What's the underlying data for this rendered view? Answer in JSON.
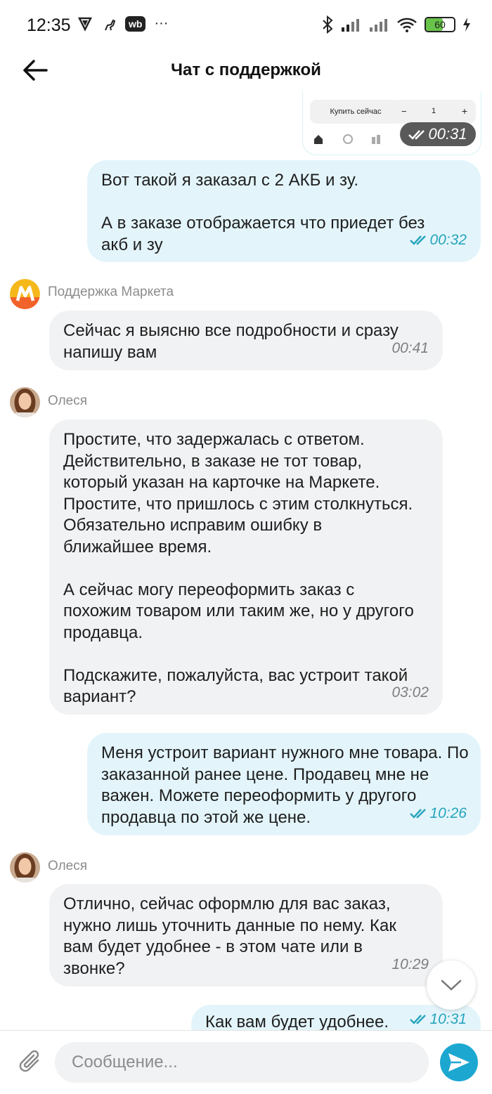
{
  "status_bar": {
    "time": "12:35",
    "wb_label": "wb",
    "more": "···",
    "battery": "60"
  },
  "header": {
    "title": "Чат с поддержкой"
  },
  "image_message": {
    "buy_label": "Купить сейчас",
    "qty_minus": "−",
    "qty_value": "1",
    "qty_plus": "+",
    "time": "00:31"
  },
  "messages": [
    {
      "direction": "out",
      "text": "Вот такой я заказал с 2 АКБ и зу.\n\nА в заказе отображается что приедет без акб и зу",
      "time": "00:32"
    },
    {
      "direction": "in",
      "sender": "Поддержка Маркета",
      "text": "Сейчас я выясню все подробности и сразу напишу вам",
      "time": "00:41"
    },
    {
      "direction": "in",
      "sender": "Олеся",
      "text": "Простите, что задержалась с ответом. Действительно, в заказе не тот товар, который указан на карточке на Маркете. Простите, что пришлось с этим столкнуться. Обязательно исправим ошибку в ближайшее время.\n\nА сейчас могу переоформить заказ с похожим товаром или таким же, но у другого продавца.\n\nПодскажите, пожалуйста, вас устроит такой вариант?",
      "time": "03:02"
    },
    {
      "direction": "out",
      "text": "Меня устроит вариант нужного мне товара. По заказанной ранее цене. Продавец мне не важен. Можете переоформить у другого продавца по этой же цене.",
      "time": "10:26"
    },
    {
      "direction": "in",
      "sender": "Олеся",
      "text": "Отлично, сейчас оформлю для вас заказ, нужно лишь уточнить данные по нему. Как вам будет удобнее - в этом чате или в звонке?",
      "time": "10:29"
    },
    {
      "direction": "out",
      "text": "Как вам будет удобнее.",
      "time": "10:31"
    }
  ],
  "composer": {
    "placeholder": "Сообщение..."
  },
  "colors": {
    "accent": "#1ca7d1",
    "outgoing_bubble": "#e3f5fb",
    "incoming_bubble": "#f1f2f4",
    "read_ticks": "#27a5bc",
    "market_logo": "#f5b81b"
  },
  "icons": [
    "back-arrow-icon",
    "paperclip-icon",
    "send-icon",
    "chevron-down-icon",
    "double-check-icon",
    "market-logo-icon"
  ]
}
